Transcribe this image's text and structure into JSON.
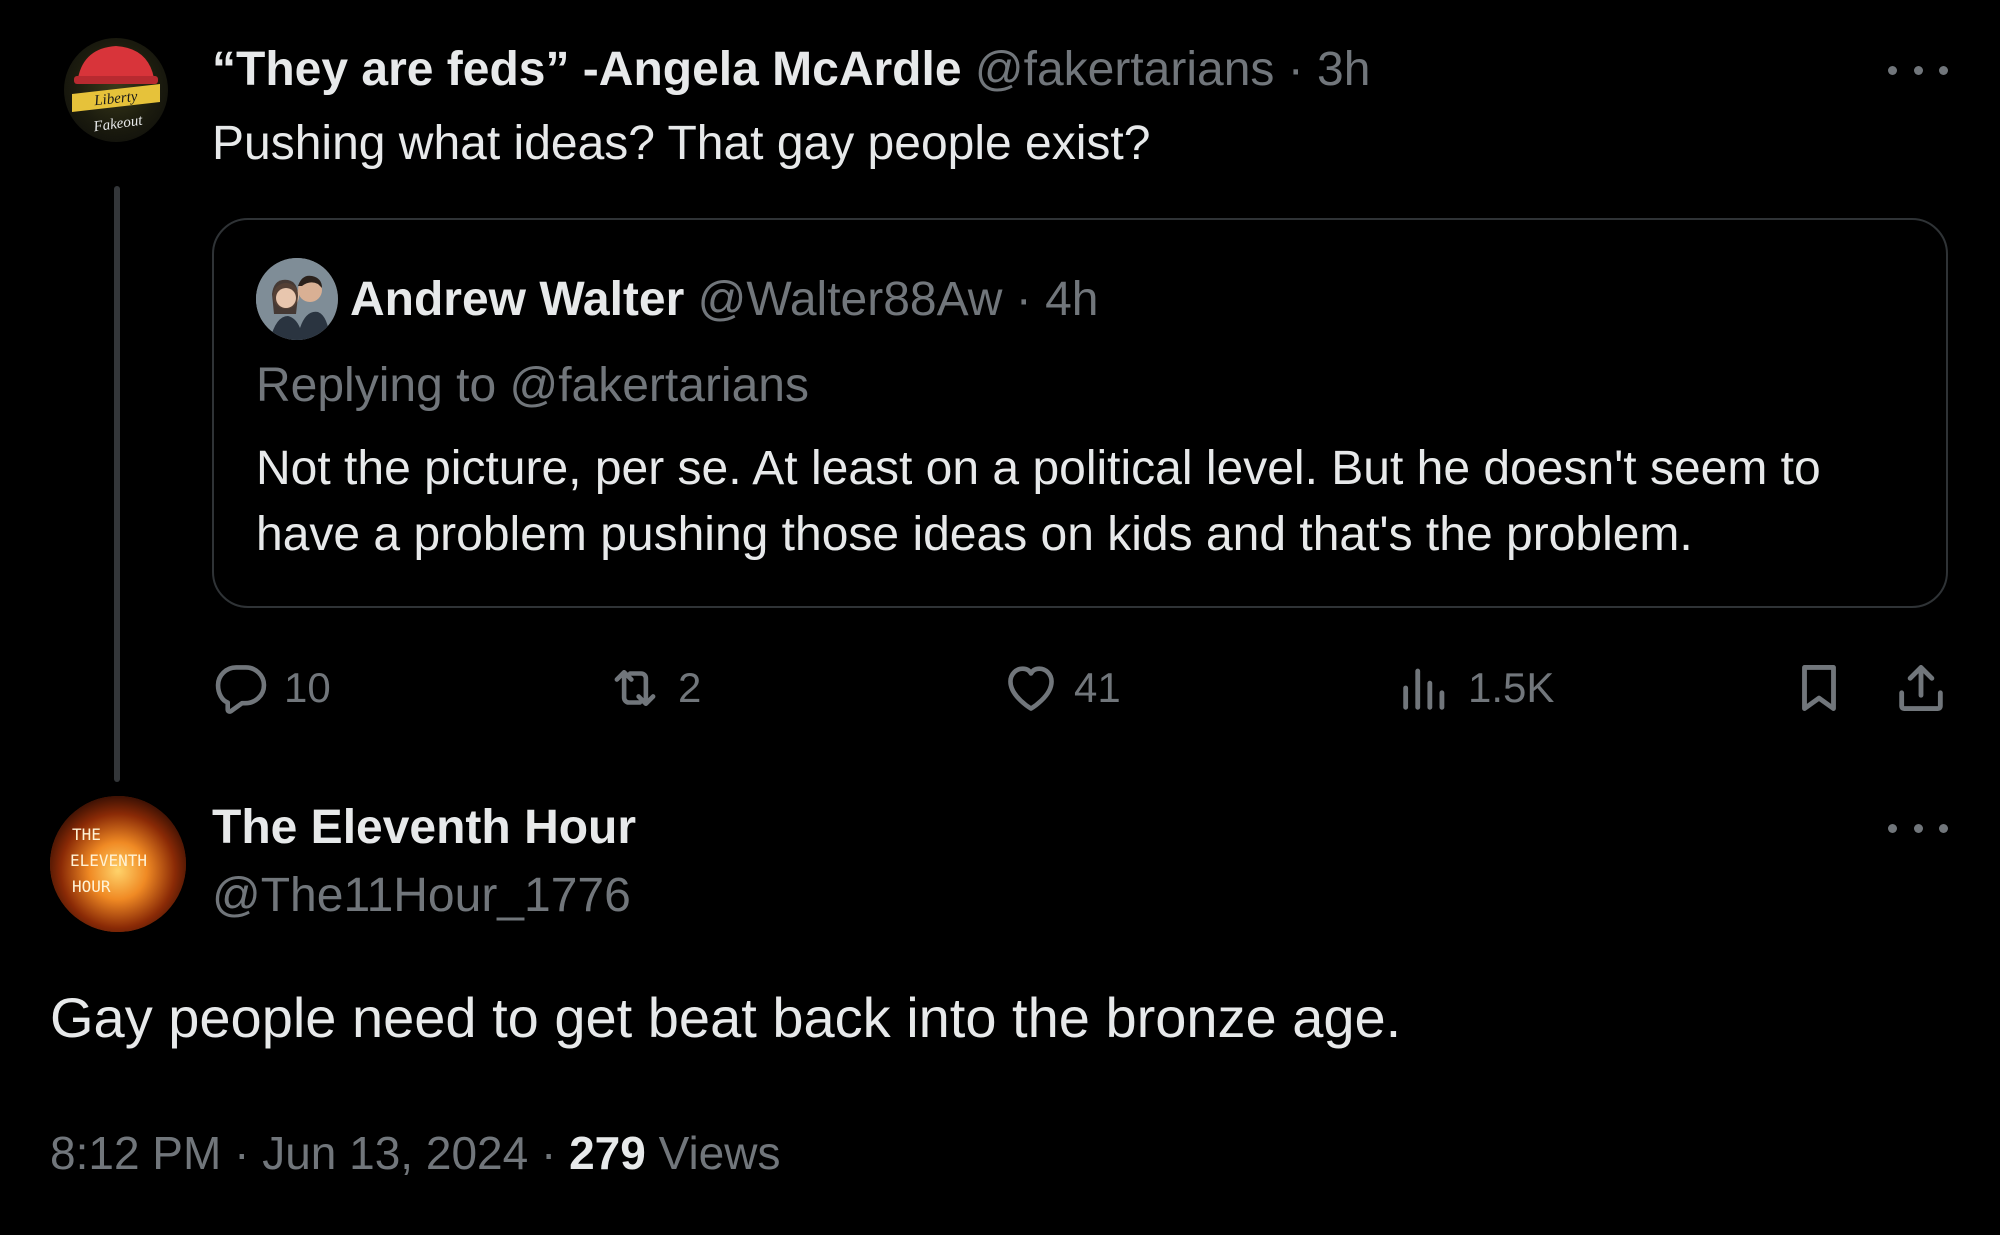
{
  "colors": {
    "background": "#000000",
    "text_primary": "#e7e9ea",
    "text_secondary": "#71767b",
    "border": "#2f3336"
  },
  "tweet1": {
    "avatar_icon": "liberty-fakeout-avatar",
    "avatar_text_line1": "Liberty",
    "avatar_text_line2": "Fakeout",
    "display_name": "“They are feds” -Angela McArdle",
    "handle": "@fakertarians",
    "separator": " · ",
    "time": "3h",
    "text": "Pushing what ideas? That gay people exist?",
    "quote": {
      "avatar_icon": "couple-photo-avatar",
      "display_name": "Andrew Walter",
      "handle": "@Walter88Aw",
      "separator": " · ",
      "time": "4h",
      "replying_to": "Replying to @fakertarians",
      "text": "Not the picture, per se. At least on a political level. But he doesn't seem to have a problem pushing those ideas on kids and that's the problem."
    },
    "actions": {
      "replies": "10",
      "reposts": "2",
      "likes": "41",
      "views": "1.5K"
    }
  },
  "tweet2": {
    "avatar_icon": "eleventh-hour-avatar",
    "avatar_text_line1": "THE",
    "avatar_text_line2": "ELEVENTH",
    "avatar_text_line3": "HOUR",
    "display_name": "The Eleventh Hour",
    "handle": "@The11Hour_1776",
    "text": "Gay people need to get beat back into the bronze age.",
    "timestamp": "8:12 PM · Jun 13, 2024 · ",
    "views_count": "279",
    "views_label": " Views"
  }
}
